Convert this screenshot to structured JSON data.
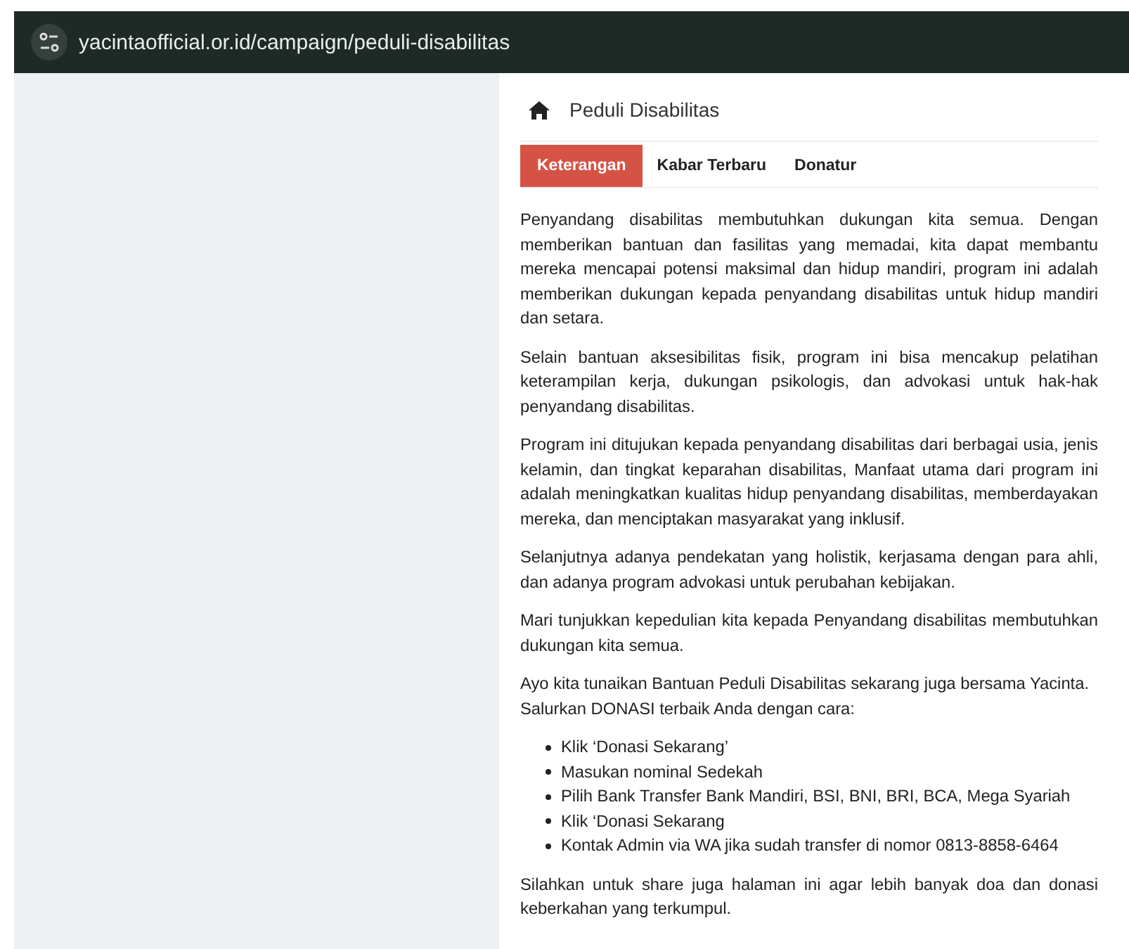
{
  "address_bar": {
    "url": "yacintaofficial.or.id/campaign/peduli-disabilitas"
  },
  "breadcrumb": {
    "title": "Peduli Disabilitas"
  },
  "tabs": [
    {
      "label": "Keterangan",
      "selected": true
    },
    {
      "label": "Kabar Terbaru",
      "selected": false
    },
    {
      "label": "Donatur",
      "selected": false
    }
  ],
  "content": [
    {
      "kind": "paragraph",
      "text": "Penyandang disabilitas membutuhkan dukungan kita semua. Dengan memberikan bantuan dan fasilitas yang memadai, kita dapat membantu mereka mencapai potensi maksimal dan hidup mandiri, program ini adalah memberikan dukungan kepada penyandang disabilitas untuk hidup mandiri dan setara."
    },
    {
      "kind": "paragraph",
      "text": "Selain bantuan aksesibilitas fisik, program ini bisa mencakup pelatihan keterampilan kerja, dukungan psikologis, dan advokasi untuk hak-hak penyandang disabilitas."
    },
    {
      "kind": "paragraph",
      "text": "Program ini ditujukan kepada penyandang disabilitas dari berbagai usia, jenis kelamin, dan tingkat keparahan disabilitas, Manfaat utama dari program ini adalah meningkatkan kualitas hidup penyandang disabilitas, memberdayakan mereka, dan menciptakan masyarakat yang inklusif."
    },
    {
      "kind": "paragraph",
      "text": "Selanjutnya adanya pendekatan yang holistik, kerjasama dengan para ahli, dan adanya program advokasi untuk perubahan kebijakan."
    },
    {
      "kind": "paragraph",
      "text": "Mari tunjukkan kepedulian kita kepada Penyandang disabilitas membutuhkan dukungan kita semua."
    },
    {
      "kind": "lines",
      "lines": [
        "Ayo kita tunaikan Bantuan Peduli Disabilitas sekarang juga bersama Yacinta.",
        "Salurkan DONASI terbaik Anda dengan cara:"
      ]
    },
    {
      "kind": "list",
      "items": [
        "Klik ‘Donasi Sekarang’",
        "Masukan nominal Sedekah",
        "Pilih Bank Transfer Bank Mandiri, BSI, BNI, BRI, BCA, Mega Syariah",
        "Klik ‘Donasi Sekarang",
        "Kontak Admin via WA jika sudah transfer di nomor 0813-8858-6464"
      ]
    },
    {
      "kind": "paragraph",
      "text": "Silahkan untuk share juga halaman ini agar lebih banyak doa dan donasi keberkahan yang terkumpul."
    }
  ]
}
